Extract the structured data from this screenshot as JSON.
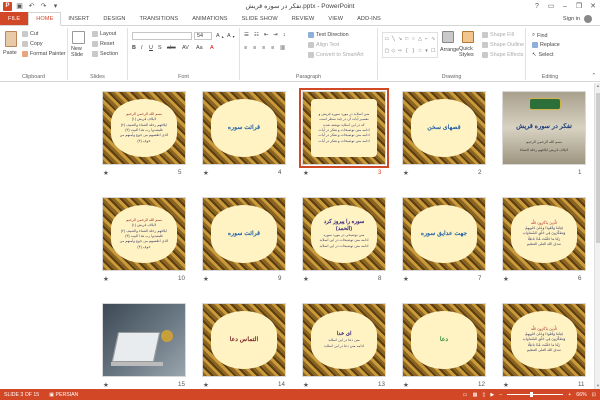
{
  "window": {
    "title": "تفکر در سوره قریش.pptx - PowerPoint",
    "controls": [
      "?",
      "▭",
      "–",
      "❐",
      "✕"
    ]
  },
  "qat": [
    "save",
    "undo",
    "redo",
    "customize"
  ],
  "tabs": [
    "FILE",
    "HOME",
    "INSERT",
    "DESIGN",
    "TRANSITIONS",
    "ANIMATIONS",
    "SLIDE SHOW",
    "REVIEW",
    "VIEW",
    "ADD-INS"
  ],
  "active_tab": "HOME",
  "account": {
    "label": "Sign in"
  },
  "ribbon": {
    "clipboard": {
      "label": "Clipboard",
      "paste": "Paste",
      "cut": "Cut",
      "copy": "Copy",
      "format_painter": "Format Painter"
    },
    "slides": {
      "label": "Slides",
      "new_slide": "New Slide",
      "layout": "Layout",
      "reset": "Reset",
      "section": "Section"
    },
    "font": {
      "label": "Font",
      "font_name": "",
      "font_size": "54"
    },
    "paragraph": {
      "label": "Paragraph",
      "text_direction": "Text Direction",
      "align_text": "Align Text",
      "convert_smartart": "Convert to SmartArt"
    },
    "drawing": {
      "label": "Drawing",
      "arrange": "Arrange",
      "quick_styles": "Quick Styles",
      "shape_fill": "Shape Fill",
      "shape_outline": "Shape Outline",
      "shape_effects": "Shape Effects"
    },
    "editing": {
      "label": "Editing",
      "find": "Find",
      "replace": "Replace",
      "select": "Select"
    }
  },
  "slides": [
    {
      "num": "1",
      "kind": "cover",
      "title": "تفکر در سوره قریش",
      "lines": [
        "بسم الله الرحمن الرحیم",
        "لایلاف قریش ایلافهم رحلة الشتاء"
      ]
    },
    {
      "num": "2",
      "kind": "title",
      "title": "قصهای سخن",
      "color": "#1f5fa8"
    },
    {
      "num": "3",
      "kind": "text",
      "selected": true,
      "lines": [
        "متن اسلاید در مورد سوره قریش و",
        "تفسیر آیات آن در چند سطر است",
        "که در این اسلاید نوشته شده",
        "ادامه متن توضیحات و تفکر در آیات",
        "ادامه متن توضیحات و تفکر در آیات",
        "ادامه متن توضیحات و تفکر در آیات"
      ]
    },
    {
      "num": "4",
      "kind": "title",
      "title": "قرائت سوره",
      "color": "#1f5fa8"
    },
    {
      "num": "5",
      "kind": "verses",
      "lines": [
        "بسم الله الرحمن الرحیم",
        "لایلاف قریش (۱)",
        "ایلافهم رحلة الشتاء والصیف (۲)",
        "فلیعبدوا رب هذا البیت (۳)",
        "الذی اطعمهم من جوع وآمنهم من خوف (۴)"
      ]
    },
    {
      "num": "6",
      "kind": "verses",
      "lines": [
        "الَّذِينَ يَذْكُرُونَ اللَّهَ",
        "قِيَامًا وَقُعُودًا وَعَلَىٰ جُنُوبِهِمْ",
        "وَيَتَفَكَّرُونَ فِي خَلْقِ السَّمَاوَاتِ",
        "رَبَّنَا مَا خَلَقْتَ هَٰذَا بَاطِلًا",
        "صدق الله العلی العظیم"
      ]
    },
    {
      "num": "7",
      "kind": "title",
      "title": "جهت عدایق سوره",
      "color": "#1f5fa8"
    },
    {
      "num": "8",
      "kind": "mixed",
      "title": "سوره را پیروز کرد (الحمد)",
      "lines": [
        "متن توضیحی در مورد سوره",
        "ادامه متن توضیحات در این اسلاید",
        "ادامه متن توضیحات در این اسلاید"
      ]
    },
    {
      "num": "9",
      "kind": "title",
      "title": "قرائت سوره",
      "color": "#1f5fa8"
    },
    {
      "num": "10",
      "kind": "verses",
      "lines": [
        "بسم الله الرحمن الرحیم",
        "لایلاف قریش (۱)",
        "ایلافهم رحلة الشتاء والصیف (۲)",
        "فلیعبدوا رب هذا البیت (۳)",
        "الذی اطعمهم من جوع وآمنهم من خوف (۴)"
      ]
    },
    {
      "num": "11",
      "kind": "verses",
      "lines": [
        "الَّذِينَ يَذْكُرُونَ اللَّهَ",
        "قِيَامًا وَقُعُودًا وَعَلَىٰ جُنُوبِهِمْ",
        "وَيَتَفَكَّرُونَ فِي خَلْقِ السَّمَاوَاتِ",
        "رَبَّنَا مَا خَلَقْتَ هَٰذَا بَاطِلًا",
        "صدق الله العلی العظیم"
      ]
    },
    {
      "num": "12",
      "kind": "title",
      "title": "دعا",
      "color": "#2e8b3a"
    },
    {
      "num": "13",
      "kind": "mixed",
      "title": "ای خدا",
      "lines": [
        "متن دعا در این اسلاید",
        "ادامه متن دعا در این اسلاید"
      ]
    },
    {
      "num": "14",
      "kind": "title",
      "title": "التماس دعا",
      "color": "#7a1f1f"
    },
    {
      "num": "15",
      "kind": "photo"
    }
  ],
  "status": {
    "slide_info": "SLIDE 3 OF 15",
    "language": "PERSIAN",
    "zoom": "66%"
  },
  "colors": {
    "accent": "#d24726",
    "selection": "#d24726"
  }
}
